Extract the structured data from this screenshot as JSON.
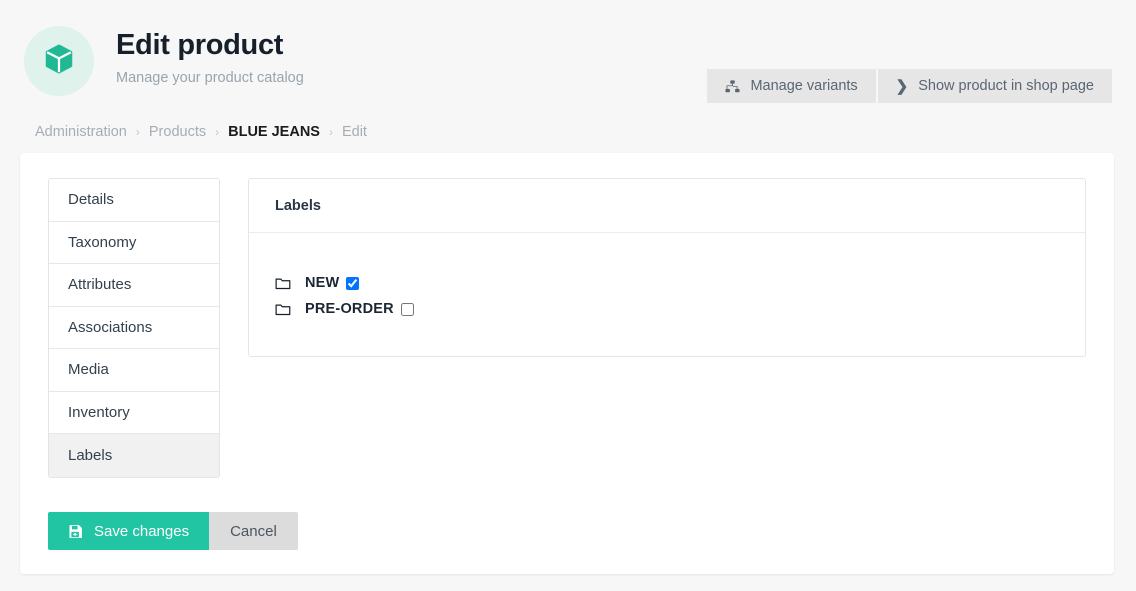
{
  "header": {
    "logo_icon": "box-cube-icon",
    "title": "Edit product",
    "subtitle": "Manage your product catalog",
    "actions": [
      {
        "label": "Manage variants",
        "icon": "sitemap-icon"
      },
      {
        "label": "Show product in shop page",
        "icon": "chevron-right-icon"
      }
    ]
  },
  "breadcrumb": {
    "separator": "›",
    "items": [
      {
        "label": "Administration",
        "current": false
      },
      {
        "label": "Products",
        "current": false
      },
      {
        "label": "BLUE JEANS",
        "current": true
      },
      {
        "label": "Edit",
        "current": false
      }
    ]
  },
  "tabs": [
    {
      "label": "Details",
      "active": false
    },
    {
      "label": "Taxonomy",
      "active": false
    },
    {
      "label": "Attributes",
      "active": false
    },
    {
      "label": "Associations",
      "active": false
    },
    {
      "label": "Media",
      "active": false
    },
    {
      "label": "Inventory",
      "active": false
    },
    {
      "label": "Labels",
      "active": true
    }
  ],
  "panel": {
    "title": "Labels",
    "rows": [
      {
        "name": "NEW",
        "checked": true,
        "icon": "folder-icon"
      },
      {
        "name": "PRE-ORDER",
        "checked": false,
        "icon": "folder-icon"
      }
    ]
  },
  "form_actions": {
    "save_label": "Save changes",
    "save_icon": "save-disk-icon",
    "cancel_label": "Cancel"
  },
  "colors": {
    "accent_green": "#21c5a3",
    "logo_bg": "#dff2ec",
    "page_bg": "#f7f7f7",
    "active_tab_bg": "#f1f1f1",
    "muted_text": "#9aa4ae"
  }
}
